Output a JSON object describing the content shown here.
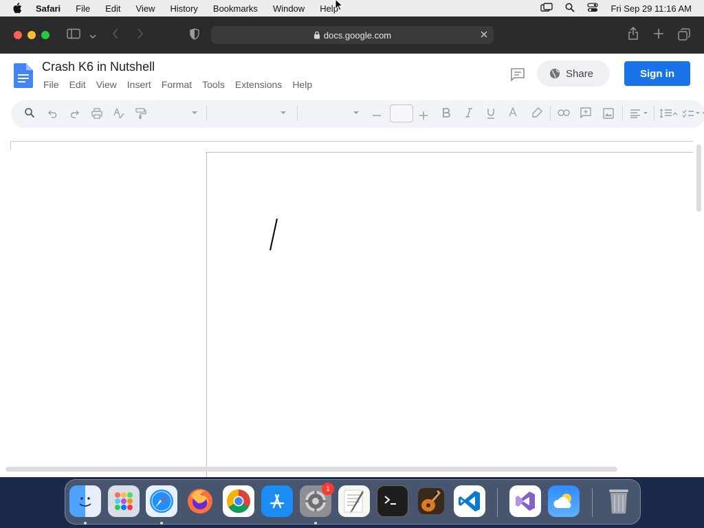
{
  "menubar": {
    "app_name": "Safari",
    "items": [
      "File",
      "Edit",
      "View",
      "History",
      "Bookmarks",
      "Window",
      "Help"
    ],
    "datetime": "Fri Sep 29  11:16 AM"
  },
  "browser": {
    "url": "docs.google.com"
  },
  "doc": {
    "title": "Crash K6 in Nutshell",
    "menus": [
      "File",
      "Edit",
      "View",
      "Insert",
      "Format",
      "Tools",
      "Extensions",
      "Help"
    ],
    "share_label": "Share",
    "signin_label": "Sign in"
  },
  "dock": {
    "apps": [
      "finder",
      "launchpad",
      "safari",
      "firefox",
      "chrome",
      "app-store",
      "system-settings",
      "textedit",
      "terminal",
      "garageband",
      "vscode",
      "visual-studio",
      "weather",
      "trash"
    ],
    "settings_badge": "1"
  },
  "colors": {
    "primary_blue": "#1a73e8",
    "toolbar_dark": "#2b2b2b",
    "docs_toolbar": "#f0f4f9"
  }
}
